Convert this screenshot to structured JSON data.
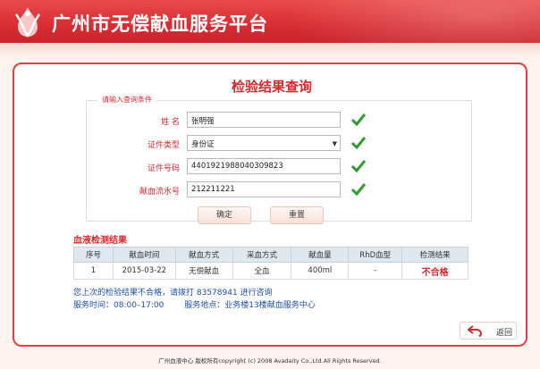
{
  "site": {
    "title": "广州市无偿献血服务平台"
  },
  "page": {
    "title": "检验结果查询"
  },
  "query": {
    "legend": "请输入查询条件",
    "fields": [
      {
        "label": "姓    名",
        "value": "张明强"
      },
      {
        "label": "证件类型",
        "value": "身份证"
      },
      {
        "label": "证件号码",
        "value": "440192198804030​9823"
      },
      {
        "label": "献血流水号",
        "value": "212211221"
      }
    ],
    "confirm_label": "确定",
    "reset_label": "重置"
  },
  "results": {
    "title": "血液检测结果",
    "columns": [
      "序号",
      "献血时间",
      "献血方式",
      "采血方式",
      "献血量",
      "RhD血型",
      "检测结果"
    ],
    "rows": [
      [
        "1",
        "2015-03-22",
        "无偿献血",
        "全血",
        "400ml",
        "-",
        "不合格"
      ]
    ]
  },
  "info": {
    "line1": "您上次的检验结果不合格，请拨打 83578941 进行咨询",
    "line2": "服务时间：08:00–17:00        服务地点：业务楼13楼献血服务中心"
  },
  "back_label": "返回",
  "footer": "广州血液中心  版权所有copyright (c) 2008 Avadaity Co.,Ltd.All Rights Reserved.",
  "colors": {
    "brand_red": "#d6282f",
    "check_green": "#2f9a2f",
    "link_blue": "#1e4fa6"
  },
  "icons": {
    "logo": "blood-drop-logo-icon",
    "check": "check-icon",
    "back": "back-arrow-icon",
    "select": "chevron-down-icon"
  }
}
